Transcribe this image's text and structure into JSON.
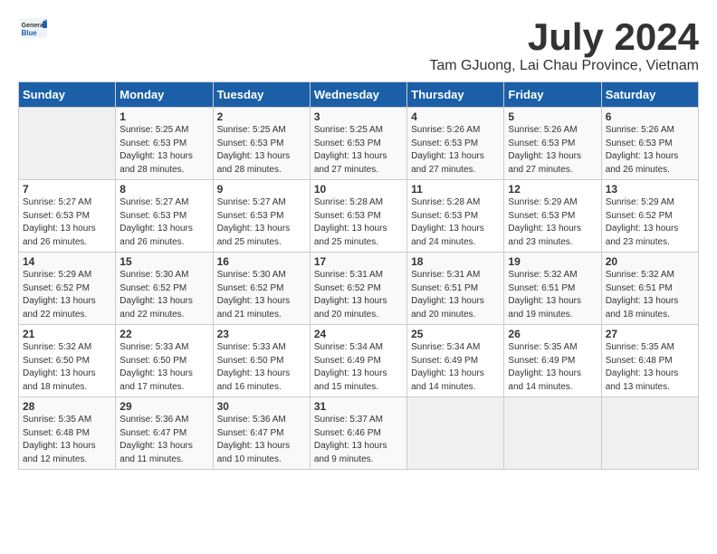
{
  "header": {
    "logo_general": "General",
    "logo_blue": "Blue",
    "month_year": "July 2024",
    "location": "Tam GJuong, Lai Chau Province, Vietnam"
  },
  "weekdays": [
    "Sunday",
    "Monday",
    "Tuesday",
    "Wednesday",
    "Thursday",
    "Friday",
    "Saturday"
  ],
  "weeks": [
    [
      {
        "day": "",
        "info": ""
      },
      {
        "day": "1",
        "info": "Sunrise: 5:25 AM\nSunset: 6:53 PM\nDaylight: 13 hours and 28 minutes."
      },
      {
        "day": "2",
        "info": "Sunrise: 5:25 AM\nSunset: 6:53 PM\nDaylight: 13 hours and 28 minutes."
      },
      {
        "day": "3",
        "info": "Sunrise: 5:25 AM\nSunset: 6:53 PM\nDaylight: 13 hours and 27 minutes."
      },
      {
        "day": "4",
        "info": "Sunrise: 5:26 AM\nSunset: 6:53 PM\nDaylight: 13 hours and 27 minutes."
      },
      {
        "day": "5",
        "info": "Sunrise: 5:26 AM\nSunset: 6:53 PM\nDaylight: 13 hours and 27 minutes."
      },
      {
        "day": "6",
        "info": "Sunrise: 5:26 AM\nSunset: 6:53 PM\nDaylight: 13 hours and 26 minutes."
      }
    ],
    [
      {
        "day": "7",
        "info": "Sunrise: 5:27 AM\nSunset: 6:53 PM\nDaylight: 13 hours and 26 minutes."
      },
      {
        "day": "8",
        "info": "Sunrise: 5:27 AM\nSunset: 6:53 PM\nDaylight: 13 hours and 26 minutes."
      },
      {
        "day": "9",
        "info": "Sunrise: 5:27 AM\nSunset: 6:53 PM\nDaylight: 13 hours and 25 minutes."
      },
      {
        "day": "10",
        "info": "Sunrise: 5:28 AM\nSunset: 6:53 PM\nDaylight: 13 hours and 25 minutes."
      },
      {
        "day": "11",
        "info": "Sunrise: 5:28 AM\nSunset: 6:53 PM\nDaylight: 13 hours and 24 minutes."
      },
      {
        "day": "12",
        "info": "Sunrise: 5:29 AM\nSunset: 6:53 PM\nDaylight: 13 hours and 23 minutes."
      },
      {
        "day": "13",
        "info": "Sunrise: 5:29 AM\nSunset: 6:52 PM\nDaylight: 13 hours and 23 minutes."
      }
    ],
    [
      {
        "day": "14",
        "info": "Sunrise: 5:29 AM\nSunset: 6:52 PM\nDaylight: 13 hours and 22 minutes."
      },
      {
        "day": "15",
        "info": "Sunrise: 5:30 AM\nSunset: 6:52 PM\nDaylight: 13 hours and 22 minutes."
      },
      {
        "day": "16",
        "info": "Sunrise: 5:30 AM\nSunset: 6:52 PM\nDaylight: 13 hours and 21 minutes."
      },
      {
        "day": "17",
        "info": "Sunrise: 5:31 AM\nSunset: 6:52 PM\nDaylight: 13 hours and 20 minutes."
      },
      {
        "day": "18",
        "info": "Sunrise: 5:31 AM\nSunset: 6:51 PM\nDaylight: 13 hours and 20 minutes."
      },
      {
        "day": "19",
        "info": "Sunrise: 5:32 AM\nSunset: 6:51 PM\nDaylight: 13 hours and 19 minutes."
      },
      {
        "day": "20",
        "info": "Sunrise: 5:32 AM\nSunset: 6:51 PM\nDaylight: 13 hours and 18 minutes."
      }
    ],
    [
      {
        "day": "21",
        "info": "Sunrise: 5:32 AM\nSunset: 6:50 PM\nDaylight: 13 hours and 18 minutes."
      },
      {
        "day": "22",
        "info": "Sunrise: 5:33 AM\nSunset: 6:50 PM\nDaylight: 13 hours and 17 minutes."
      },
      {
        "day": "23",
        "info": "Sunrise: 5:33 AM\nSunset: 6:50 PM\nDaylight: 13 hours and 16 minutes."
      },
      {
        "day": "24",
        "info": "Sunrise: 5:34 AM\nSunset: 6:49 PM\nDaylight: 13 hours and 15 minutes."
      },
      {
        "day": "25",
        "info": "Sunrise: 5:34 AM\nSunset: 6:49 PM\nDaylight: 13 hours and 14 minutes."
      },
      {
        "day": "26",
        "info": "Sunrise: 5:35 AM\nSunset: 6:49 PM\nDaylight: 13 hours and 14 minutes."
      },
      {
        "day": "27",
        "info": "Sunrise: 5:35 AM\nSunset: 6:48 PM\nDaylight: 13 hours and 13 minutes."
      }
    ],
    [
      {
        "day": "28",
        "info": "Sunrise: 5:35 AM\nSunset: 6:48 PM\nDaylight: 13 hours and 12 minutes."
      },
      {
        "day": "29",
        "info": "Sunrise: 5:36 AM\nSunset: 6:47 PM\nDaylight: 13 hours and 11 minutes."
      },
      {
        "day": "30",
        "info": "Sunrise: 5:36 AM\nSunset: 6:47 PM\nDaylight: 13 hours and 10 minutes."
      },
      {
        "day": "31",
        "info": "Sunrise: 5:37 AM\nSunset: 6:46 PM\nDaylight: 13 hours and 9 minutes."
      },
      {
        "day": "",
        "info": ""
      },
      {
        "day": "",
        "info": ""
      },
      {
        "day": "",
        "info": ""
      }
    ]
  ]
}
